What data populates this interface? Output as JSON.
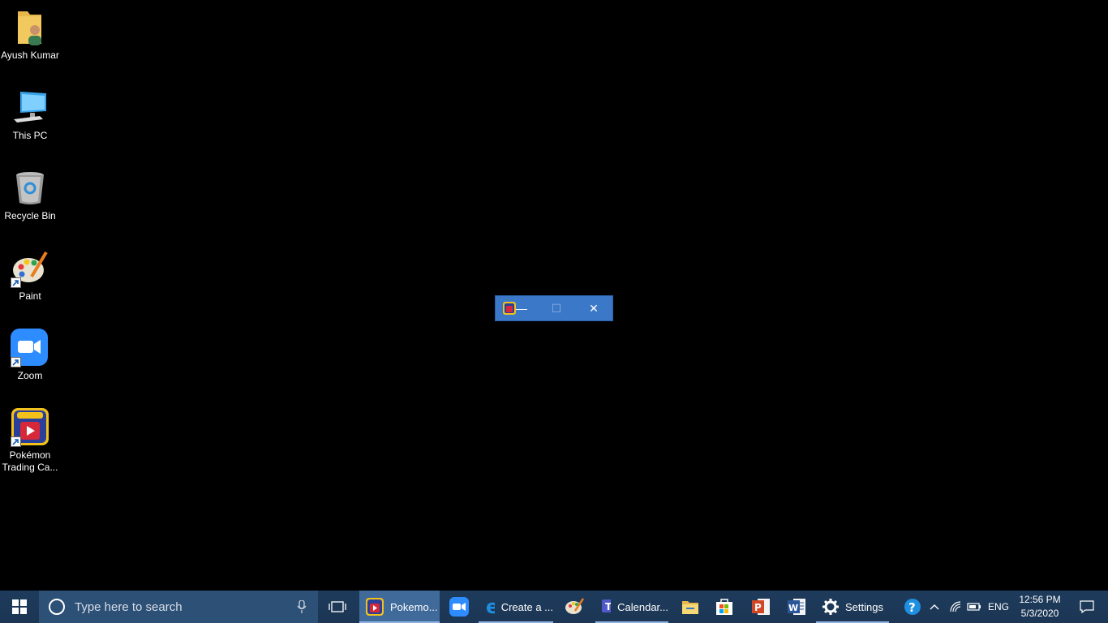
{
  "desktop": {
    "icons": [
      {
        "label": "Ayush Kumar",
        "icon": "user-folder-icon"
      },
      {
        "label": "This PC",
        "icon": "computer-icon"
      },
      {
        "label": "Recycle Bin",
        "icon": "recycle-bin-icon"
      },
      {
        "label": "Paint",
        "icon": "paint-palette-icon"
      },
      {
        "label": "Zoom",
        "icon": "zoom-camera-icon"
      },
      {
        "label": "Pokémon Trading Ca...",
        "icon": "pokemon-tcg-icon"
      }
    ]
  },
  "mini_window": {
    "minimize": "—",
    "maximize": "☐",
    "close": "✕"
  },
  "taskbar": {
    "search_placeholder": "Type here to search",
    "apps": [
      {
        "label": "Pokemo...",
        "icon": "pokemon-tcg-icon",
        "active": true
      },
      {
        "label": "",
        "icon": "zoom-camera-icon"
      },
      {
        "label": "Create a ...",
        "icon": "edge-icon"
      },
      {
        "label": "",
        "icon": "paint-palette-icon"
      },
      {
        "label": "Calendar...",
        "icon": "teams-icon"
      },
      {
        "label": "",
        "icon": "file-explorer-icon"
      },
      {
        "label": "",
        "icon": "store-icon"
      },
      {
        "label": "",
        "icon": "powerpoint-icon"
      },
      {
        "label": "",
        "icon": "word-icon"
      },
      {
        "label": "Settings",
        "icon": "gear-icon"
      }
    ],
    "tray": {
      "language": "ENG",
      "time": "12:56 PM",
      "date": "5/3/2020"
    }
  },
  "colors": {
    "taskbar": "#1e3b5c",
    "search_box": "#2d5077",
    "window_title": "#3c78c8",
    "accent": "#8fb3e0"
  }
}
